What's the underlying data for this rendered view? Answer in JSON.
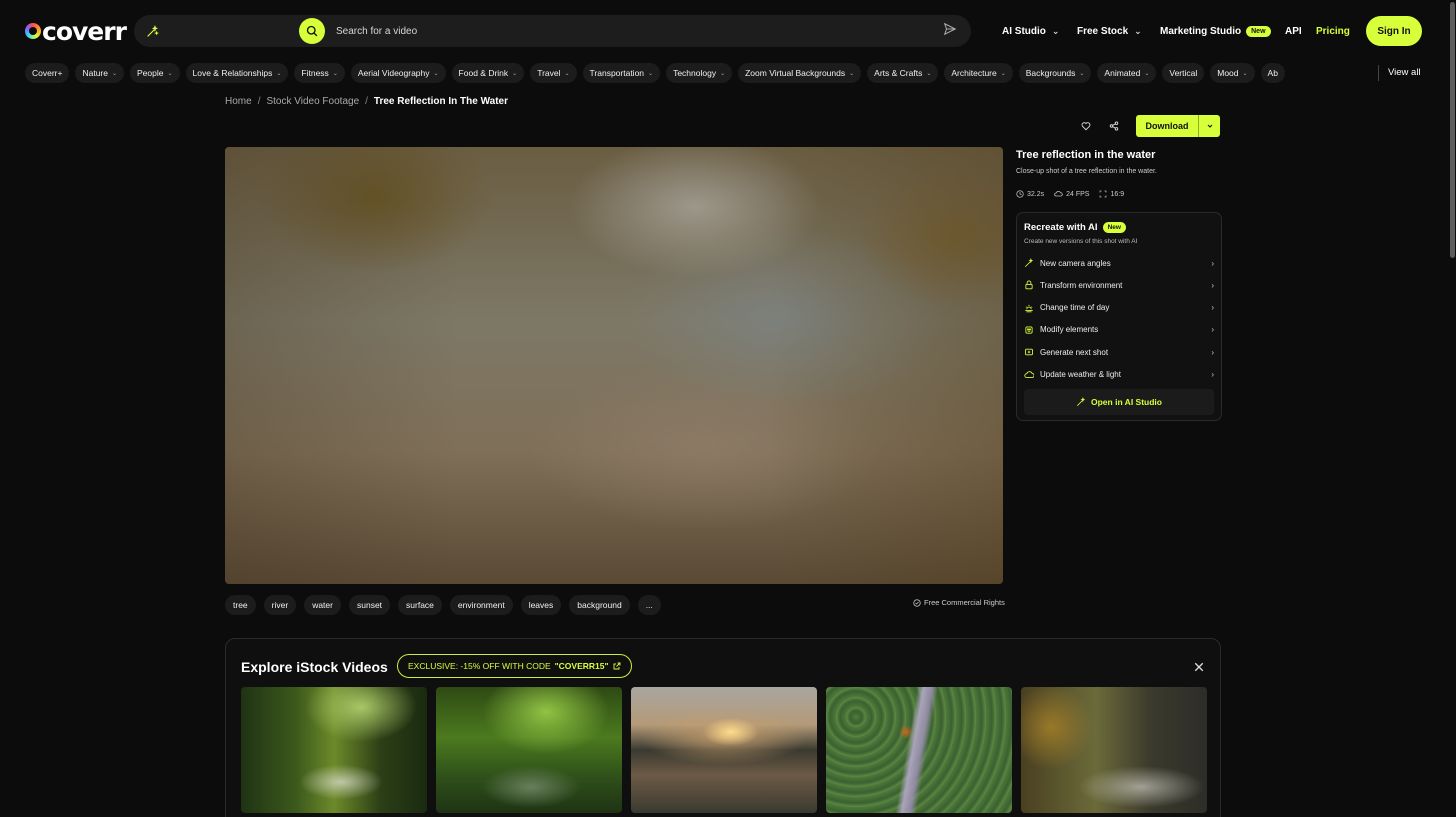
{
  "header": {
    "logo_text": "coverr",
    "search": {
      "placeholder": "Search for a video",
      "value": ""
    },
    "nav": {
      "ai_studio": "AI Studio",
      "free_stock": "Free Stock",
      "marketing_studio": "Marketing Studio",
      "marketing_badge": "New",
      "api": "API",
      "pricing": "Pricing",
      "sign_in": "Sign In"
    },
    "colors": {
      "accent": "#d7ff3a",
      "background": "#0c0c0c"
    }
  },
  "categories": {
    "items": [
      {
        "label": "Coverr+",
        "has_menu": false
      },
      {
        "label": "Nature",
        "has_menu": true
      },
      {
        "label": "People",
        "has_menu": true
      },
      {
        "label": "Love & Relationships",
        "has_menu": true
      },
      {
        "label": "Fitness",
        "has_menu": true
      },
      {
        "label": "Aerial Videography",
        "has_menu": true
      },
      {
        "label": "Food & Drink",
        "has_menu": true
      },
      {
        "label": "Travel",
        "has_menu": true
      },
      {
        "label": "Transportation",
        "has_menu": true
      },
      {
        "label": "Technology",
        "has_menu": true
      },
      {
        "label": "Zoom Virtual Backgrounds",
        "has_menu": true
      },
      {
        "label": "Arts & Crafts",
        "has_menu": true
      },
      {
        "label": "Architecture",
        "has_menu": true
      },
      {
        "label": "Backgrounds",
        "has_menu": true
      },
      {
        "label": "Animated",
        "has_menu": true
      },
      {
        "label": "Vertical",
        "has_menu": false
      },
      {
        "label": "Mood",
        "has_menu": true
      },
      {
        "label": "Ab",
        "has_menu": false
      }
    ],
    "view_all": "View all"
  },
  "breadcrumb": {
    "home": "Home",
    "section": "Stock Video Footage",
    "current": "Tree Reflection In The Water"
  },
  "video": {
    "title": "Tree reflection in the water",
    "description": "Close-up shot of a tree reflection in the water.",
    "duration": "32.2s",
    "fps": "24 FPS",
    "aspect": "16:9",
    "download_label": "Download",
    "tags": [
      "tree",
      "river",
      "water",
      "sunset",
      "surface",
      "environment",
      "leaves",
      "background",
      "..."
    ],
    "rights": "Free Commercial Rights"
  },
  "ai_panel": {
    "title": "Recreate with AI",
    "badge": "New",
    "subtitle": "Create new versions of this shot with AI",
    "options": [
      {
        "label": "New camera angles",
        "icon": "camera-angles-icon"
      },
      {
        "label": "Transform environment",
        "icon": "environment-icon"
      },
      {
        "label": "Change time of day",
        "icon": "sunrise-icon"
      },
      {
        "label": "Modify elements",
        "icon": "elements-icon"
      },
      {
        "label": "Generate next shot",
        "icon": "next-shot-icon"
      },
      {
        "label": "Update weather & light",
        "icon": "weather-icon"
      }
    ],
    "open_label": "Open in AI Studio"
  },
  "explore": {
    "title": "Explore iStock Videos",
    "promo_prefix": "EXCLUSIVE: -15% OFF WITH CODE",
    "promo_code": "\"COVERR15\"",
    "thumbnails": [
      "forest-stream-thumb",
      "mossy-creek-thumb",
      "sunset-lake-thumb",
      "aerial-forest-river-thumb",
      "misty-autumn-forest-thumb"
    ]
  }
}
